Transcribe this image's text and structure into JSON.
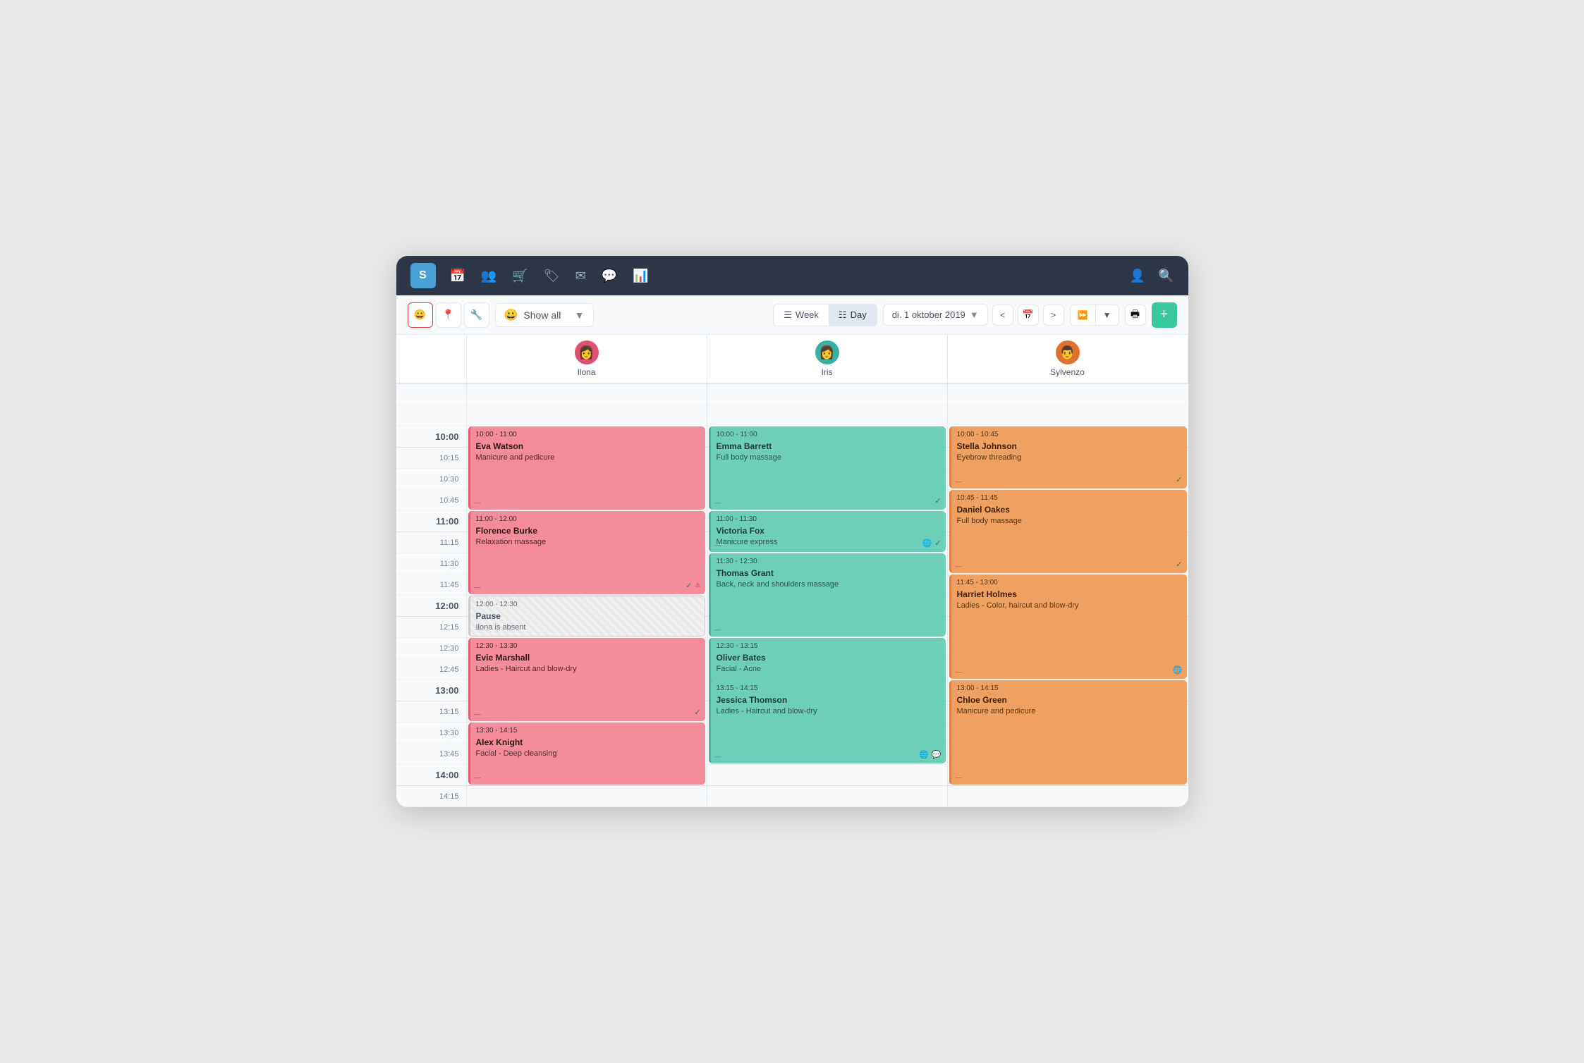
{
  "app": {
    "logo": "S",
    "nav_icons": [
      "calendar",
      "users",
      "cart",
      "tag",
      "mail",
      "chat",
      "chart"
    ]
  },
  "toolbar": {
    "filter_icons": [
      "face",
      "location",
      "wrench"
    ],
    "show_all_label": "Show all",
    "view_week_label": "Week",
    "view_day_label": "Day",
    "date_label": "di. 1 oktober 2019",
    "add_label": "+"
  },
  "staff": [
    {
      "name": "Ilona",
      "avatar_color": "#e05070",
      "avatar_emoji": "👩"
    },
    {
      "name": "Iris",
      "avatar_color": "#38b2a0",
      "avatar_emoji": "👩"
    },
    {
      "name": "Sylvenzo",
      "avatar_color": "#e07030",
      "avatar_emoji": "👨"
    }
  ],
  "time_slots": [
    {
      "label": "",
      "is_hour": false
    },
    {
      "label": "",
      "is_hour": false
    },
    {
      "label": "10:00",
      "is_hour": true
    },
    {
      "label": "10:15",
      "is_hour": false
    },
    {
      "label": "10:30",
      "is_hour": false
    },
    {
      "label": "10:45",
      "is_hour": false
    },
    {
      "label": "11:00",
      "is_hour": true
    },
    {
      "label": "11:15",
      "is_hour": false
    },
    {
      "label": "11:30",
      "is_hour": false
    },
    {
      "label": "11:45",
      "is_hour": false
    },
    {
      "label": "12:00",
      "is_hour": true
    },
    {
      "label": "12:15",
      "is_hour": false
    },
    {
      "label": "12:30",
      "is_hour": false
    },
    {
      "label": "12:45",
      "is_hour": false
    },
    {
      "label": "13:00",
      "is_hour": true
    },
    {
      "label": "13:15",
      "is_hour": false
    },
    {
      "label": "13:30",
      "is_hour": false
    },
    {
      "label": "13:45",
      "is_hour": false
    },
    {
      "label": "14:00",
      "is_hour": true
    },
    {
      "label": "14:15",
      "is_hour": false
    }
  ],
  "appointments": {
    "ilona": [
      {
        "id": "ilona-1",
        "time": "10:00 - 11:00",
        "name": "Eva Watson",
        "service": "Manicure and pedicure",
        "color": "pink",
        "top_slot": 2,
        "duration_slots": 4,
        "icons": []
      },
      {
        "id": "ilona-2",
        "time": "11:00 - 12:00",
        "name": "Florence Burke",
        "service": "Relaxation massage",
        "color": "pink",
        "top_slot": 6,
        "duration_slots": 4,
        "icons": [
          "check",
          "warning"
        ]
      },
      {
        "id": "ilona-3",
        "time": "12:00 - 12:30",
        "name": "Pause",
        "service": "Ilona is absent",
        "color": "gray",
        "top_slot": 10,
        "duration_slots": 2,
        "icons": []
      },
      {
        "id": "ilona-4",
        "time": "12:30 - 13:30",
        "name": "Evie Marshall",
        "service": "Ladies - Haircut and blow-dry",
        "color": "pink",
        "top_slot": 12,
        "duration_slots": 4,
        "icons": [
          "check"
        ]
      },
      {
        "id": "ilona-5",
        "time": "13:30 - 14:15",
        "name": "Alex Knight",
        "service": "Facial - Deep cleansing",
        "color": "pink",
        "top_slot": 16,
        "duration_slots": 3,
        "icons": []
      }
    ],
    "iris": [
      {
        "id": "iris-1",
        "time": "10:00 - 11:00",
        "name": "Emma Barrett",
        "service": "Full body massage",
        "color": "teal",
        "top_slot": 2,
        "duration_slots": 4,
        "icons": [
          "check"
        ]
      },
      {
        "id": "iris-2",
        "time": "11:00 - 11:30",
        "name": "Victoria Fox",
        "service": "Manicure express",
        "color": "teal",
        "top_slot": 6,
        "duration_slots": 2,
        "icons": [
          "globe",
          "check"
        ]
      },
      {
        "id": "iris-3",
        "time": "11:30 - 12:30",
        "name": "Thomas Grant",
        "service": "Back, neck and shoulders massage",
        "color": "teal",
        "top_slot": 8,
        "duration_slots": 4,
        "icons": []
      },
      {
        "id": "iris-4",
        "time": "12:30 - 13:15",
        "name": "Oliver Bates",
        "service": "Facial - Acne",
        "color": "teal",
        "top_slot": 12,
        "duration_slots": 3,
        "icons": []
      },
      {
        "id": "iris-5",
        "time": "13:15 - 14:15",
        "name": "Jessica Thomson",
        "service": "Ladies - Haircut and blow-dry",
        "color": "teal",
        "top_slot": 14,
        "duration_slots": 4,
        "icons": [
          "globe",
          "chat"
        ]
      }
    ],
    "sylvenzo": [
      {
        "id": "sylvenzo-1",
        "time": "10:00 - 10:45",
        "name": "Stella Johnson",
        "service": "Eyebrow threading",
        "color": "orange",
        "top_slot": 2,
        "duration_slots": 3,
        "icons": [
          "check"
        ]
      },
      {
        "id": "sylvenzo-2",
        "time": "10:45 - 11:45",
        "name": "Daniel Oakes",
        "service": "Full body massage",
        "color": "orange",
        "top_slot": 5,
        "duration_slots": 4,
        "icons": [
          "check"
        ]
      },
      {
        "id": "sylvenzo-3",
        "time": "11:45 - 13:00",
        "name": "Harriet Holmes",
        "service": "Ladies - Color, haircut and blow-dry",
        "color": "orange",
        "top_slot": 9,
        "duration_slots": 5,
        "icons": [
          "globe"
        ]
      },
      {
        "id": "sylvenzo-4",
        "time": "13:00 - 14:15",
        "name": "Chloe Green",
        "service": "Manicure and pedicure",
        "color": "orange",
        "top_slot": 14,
        "duration_slots": 5,
        "icons": []
      }
    ]
  }
}
